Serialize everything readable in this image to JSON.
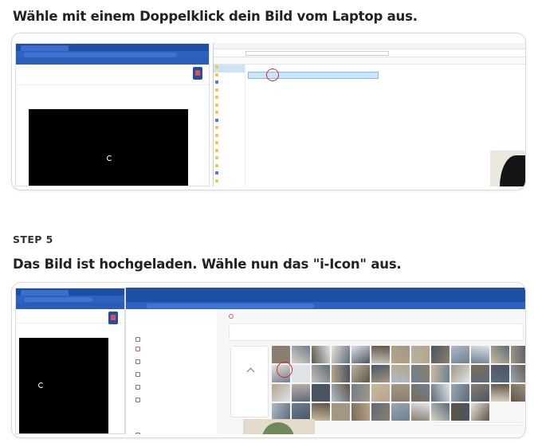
{
  "headings": {
    "first": "Wähle mit einem Doppelklick dein Bild vom Laptop aus.",
    "step_label": "STEP 5",
    "second": "Das Bild ist hochgeladen. Wähle nun das \"i-Icon\" aus."
  },
  "colors": {
    "accent_red_circle": "#d92a2a",
    "browser_blue": "#1f4fa3",
    "editor_black": "#000000"
  }
}
